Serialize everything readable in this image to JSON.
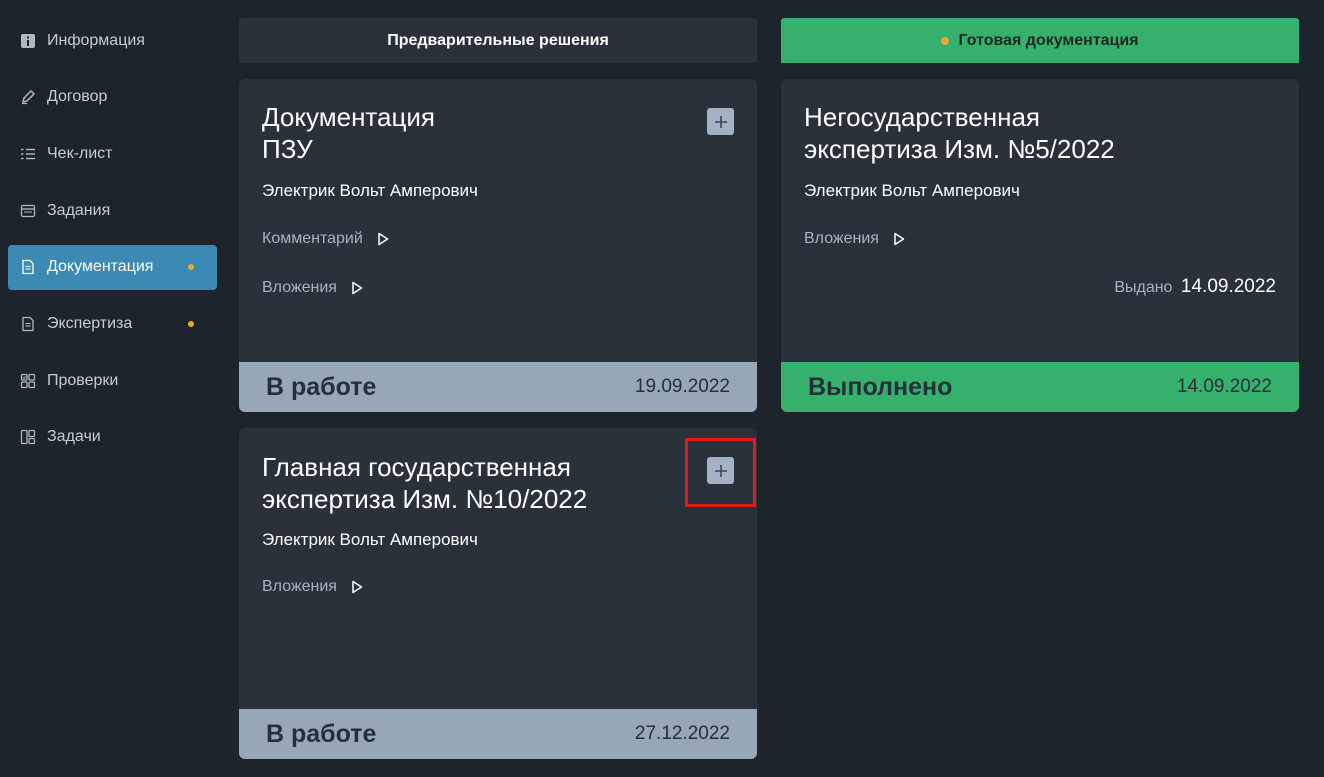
{
  "sidebar": {
    "items": [
      {
        "label": "Информация",
        "icon": "info-icon",
        "active": false,
        "dot": false
      },
      {
        "label": "Договор",
        "icon": "pen-icon",
        "active": false,
        "dot": false
      },
      {
        "label": "Чек-лист",
        "icon": "checklist-icon",
        "active": false,
        "dot": false
      },
      {
        "label": "Задания",
        "icon": "window-icon",
        "active": false,
        "dot": false
      },
      {
        "label": "Документация",
        "icon": "document-icon",
        "active": true,
        "dot": true
      },
      {
        "label": "Экспертиза",
        "icon": "document-icon",
        "active": false,
        "dot": true
      },
      {
        "label": "Проверки",
        "icon": "check-grid-icon",
        "active": false,
        "dot": false
      },
      {
        "label": "Задачи",
        "icon": "columns-icon",
        "active": false,
        "dot": false
      }
    ]
  },
  "columns": {
    "preliminary": {
      "title": "Предварительные решения"
    },
    "ready": {
      "title": "Готовая документация"
    }
  },
  "cards": {
    "pzu": {
      "title_line1": "Документация",
      "title_line2": "ПЗУ",
      "author": "Электрик Вольт Амперович",
      "comment_label": "Комментарий",
      "attachments_label": "Вложения",
      "status": "В работе",
      "date": "19.09.2022"
    },
    "main_expertise": {
      "title_line1": "Главная государственная",
      "title_line2": "экспертиза Изм. №10/2022",
      "author": "Электрик Вольт Амперович",
      "attachments_label": "Вложения",
      "status": "В работе",
      "date": "27.12.2022"
    },
    "nongov": {
      "title_line1": "Негосударственная",
      "title_line2": "экспертиза Изм. №5/2022",
      "author": "Электрик Вольт Амперович",
      "attachments_label": "Вложения",
      "issued_label": "Выдано",
      "issued_date": "14.09.2022",
      "status": "Выполнено",
      "date": "14.09.2022"
    }
  },
  "colors": {
    "accent": "#3a8ab4",
    "success": "#35b06d",
    "warning_dot": "#f0a830",
    "highlight": "#e01a1a"
  }
}
